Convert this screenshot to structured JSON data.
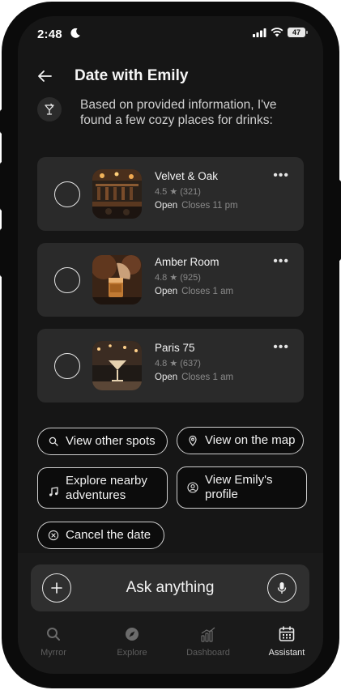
{
  "status_bar": {
    "time": "2:48",
    "battery": "47"
  },
  "header": {
    "title": "Date with Emily"
  },
  "message": {
    "text": "Based on provided information, I've found a few cozy places for drinks:"
  },
  "places": [
    {
      "name": "Velvet & Oak",
      "rating": "4.5 ★ (321)",
      "status": "Open",
      "hours": "Closes 11 pm"
    },
    {
      "name": "Amber Room",
      "rating": "4.8 ★ (925)",
      "status": "Open",
      "hours": "Closes 1 am"
    },
    {
      "name": "Paris 75",
      "rating": "4.8 ★ (637)",
      "status": "Open",
      "hours": "Closes 1 am"
    }
  ],
  "actions": {
    "other_spots": "View other spots",
    "map": "View on the map",
    "explore": "Explore nearby adventures",
    "profile": "View Emily's profile",
    "cancel": "Cancel the date"
  },
  "input": {
    "placeholder": "Ask anything"
  },
  "tabs": [
    {
      "label": "Myrror",
      "icon": "search-icon",
      "active": false
    },
    {
      "label": "Explore",
      "icon": "compass-icon",
      "active": false
    },
    {
      "label": "Dashboard",
      "icon": "chart-icon",
      "active": false
    },
    {
      "label": "Assistant",
      "icon": "calendar-icon",
      "active": true
    }
  ],
  "colors": {
    "background": "#161616",
    "card": "#2a2a2a",
    "chip_border": "#cfcfcf",
    "muted": "#8a8a8a"
  }
}
